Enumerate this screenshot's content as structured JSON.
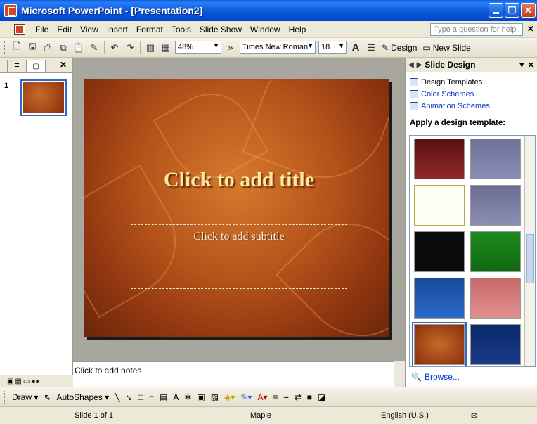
{
  "window": {
    "title": "Microsoft PowerPoint - [Presentation2]"
  },
  "menubar": {
    "items": [
      "File",
      "Edit",
      "View",
      "Insert",
      "Format",
      "Tools",
      "Slide Show",
      "Window",
      "Help"
    ],
    "help_placeholder": "Type a question for help"
  },
  "toolbar": {
    "zoom": "48%",
    "font_name": "Times New Roman",
    "font_size": "18",
    "design_label": "Design",
    "new_slide_label": "New Slide"
  },
  "left_pane": {
    "slide_number": "1"
  },
  "slide": {
    "title_placeholder": "Click to add title",
    "subtitle_placeholder": "Click to add subtitle"
  },
  "notes": {
    "placeholder": "Click to add notes"
  },
  "task_pane": {
    "title": "Slide Design",
    "links": {
      "design_templates": "Design Templates",
      "color_schemes": "Color Schemes",
      "animation_schemes": "Animation Schemes"
    },
    "section_heading": "Apply a design template:",
    "browse_label": "Browse..."
  },
  "draw_toolbar": {
    "draw_label": "Draw",
    "autoshapes_label": "AutoShapes"
  },
  "statusbar": {
    "slide_position": "Slide 1 of 1",
    "design_name": "Maple",
    "language": "English (U.S.)"
  },
  "colors": {
    "titlebar": "#0A5FE0",
    "slide_background": "#B4531A",
    "title_text": "#FFE9A0",
    "link_blue": "#0033CC"
  }
}
